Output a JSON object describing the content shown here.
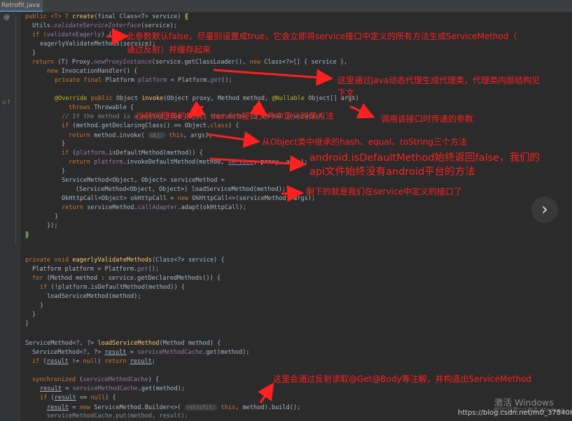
{
  "tab": {
    "title": "Retrofit.java"
  },
  "gutter": {
    "override_mark": "@",
    "impl_mark": "o↑"
  },
  "code": {
    "l1": {
      "a": "public <T> T ",
      "b": "create",
      "c": "(final Class<T> service) ",
      "d": "{"
    },
    "l2": {
      "a": "Utils.",
      "b": "validateServiceInterface",
      "c": "(service);"
    },
    "l3": {
      "a": "if (",
      "b": "validateEagerly",
      "c": ") {"
    },
    "l4": {
      "a": "eagerlyValidateMethods(service);"
    },
    "l5": {
      "a": "}"
    },
    "l6": {
      "a": "return ",
      "b": "(T) Proxy.",
      "c": "newProxyInstance",
      "d": "(service.getClassLoader(), ",
      "e": "new ",
      "f": "Class<?>[] { service },"
    },
    "l7": {
      "a": "new ",
      "b": "InvocationHandler() {"
    },
    "l8": {
      "a": "private final ",
      "b": "Platform ",
      "c": "platform",
      "d": " = Platform.",
      "e": "get",
      "f": "();"
    },
    "l9": {
      "a": "@Override ",
      "b": "public ",
      "c": "Object ",
      "d": "invoke",
      "e": "(Object proxy, Method method, ",
      "f": "@Nullable ",
      "g": "Object[] args)"
    },
    "l10": {
      "a": "throws ",
      "b": "Throwable {"
    },
    "l11": {
      "a": "// If the method is a method from Object then defer to normal invocation."
    },
    "l12": {
      "a": "if ",
      "b": "(method.getDeclaringClass() == Object.",
      "c": "class",
      "d": ") {"
    },
    "l13": {
      "a": "return ",
      "b": "method.invoke( ",
      "h": "obj:",
      "c": " this",
      "d": ", args);"
    },
    "l14": {
      "a": "}"
    },
    "l15": {
      "a": "if ",
      "b": "(",
      "c": "platform",
      "d": ".isDefaultMethod(method)) {"
    },
    "l16": {
      "a": "return ",
      "b": "platform",
      "c": ".invokeDefaultMethod(method, ",
      "d": "service",
      "e": ", proxy, args);"
    },
    "l17": {
      "a": "}"
    },
    "l18": {
      "a": "ServiceMethod<Object, Object> serviceMethod ="
    },
    "l19": {
      "a": "(ServiceMethod<Object, Object>) loadServiceMethod(method);"
    },
    "l20": {
      "a": "OkHttpCall<Object> okHttpCall = ",
      "b": "new ",
      "c": "OkHttpCall<>(serviceMethod, args);"
    },
    "l21": {
      "a": "return ",
      "b": "serviceMethod.",
      "c": "callAdapter",
      "d": ".adapt(okHttpCall);"
    },
    "l22": {
      "a": "}"
    },
    "l23": {
      "a": "});"
    },
    "l24": {
      "a": "}"
    },
    "l25": {
      "a": "private void ",
      "b": "eagerlyValidateMethods",
      "c": "(Class<?> service) {"
    },
    "l26": {
      "a": "Platform platform = Platform.",
      "b": "get",
      "c": "();"
    },
    "l27": {
      "a": "for ",
      "b": "(Method method : service.getDeclaredMethods()) {"
    },
    "l28": {
      "a": "if ",
      "b": "(!platform.isDefaultMethod(method)) {"
    },
    "l29": {
      "a": "loadServiceMethod(method);"
    },
    "l30": {
      "a": "}"
    },
    "l31": {
      "a": "}"
    },
    "l32": {
      "a": "}"
    },
    "l33": {
      "a": "ServiceMethod<?, ?> ",
      "b": "loadServiceMethod",
      "c": "(Method method) {"
    },
    "l34": {
      "a": "ServiceMethod<?, ?> ",
      "b": "result",
      "c": " = ",
      "d": "serviceMethodCache",
      "e": ".get(method);"
    },
    "l35": {
      "a": "if ",
      "b": "(",
      "c": "result",
      "d": " != ",
      "e": "null",
      "f": ") ",
      "g": "return ",
      "h": "result",
      "i": ";"
    },
    "l36": {
      "a": "synchronized ",
      "b": "(",
      "c": "serviceMethodCache",
      "d": ") {"
    },
    "l37": {
      "a": "result",
      "b": " = ",
      "c": "serviceMethodCache",
      "d": ".get(method);"
    },
    "l38": {
      "a": "if ",
      "b": "(",
      "c": "result",
      "d": " == ",
      "e": "null",
      "f": ") {"
    },
    "l39": {
      "a": "result",
      "b": " = ",
      "c": "new ",
      "d": "ServiceMethod.Builder<>( ",
      "h": "retrofit:",
      "e": " this",
      "f": ", method).build();"
    },
    "l40": {
      "a": "serviceMethodCache.put(method, result);"
    }
  },
  "annotations": {
    "n1": "此参数默认false，尽量别设置成true，它会立即将service接口中定义的所有方法生成ServiceMethod（",
    "n1b": "通过反射）并缓存起来",
    "n2": "这里通过java动态代理生成代理类，代理类内部结构见",
    "n2b": "下文",
    "n3": "当前代理类的实例，service接口文件中定义的某方法",
    "n4": "调用该接口时传递的参数",
    "n5": "从Object类中继承的hash、equal、toString三个方法",
    "n6": "android.isDefaultMethod始终返回false，我们的",
    "n6b": "api文件始终没有android平台的方法",
    "n7": "剩下的就是我们在service中定义的接口了",
    "n8": "这里会通过反射读取@Get@Body等注解，并构造出ServiceMethod"
  },
  "overlay": {
    "next_glyph": "›",
    "win_activate_title": "激活 Windows",
    "win_activate_sub": "转到\"设置\"以激活 Windows。",
    "blog_watermark": "https://blog.csdn.net/m0_37840695"
  },
  "colors": {
    "annotation_red": "#ff2020",
    "keyword": "#cc7832",
    "method": "#ffc66d",
    "field": "#9876aa",
    "background": "#2b2b2b"
  }
}
